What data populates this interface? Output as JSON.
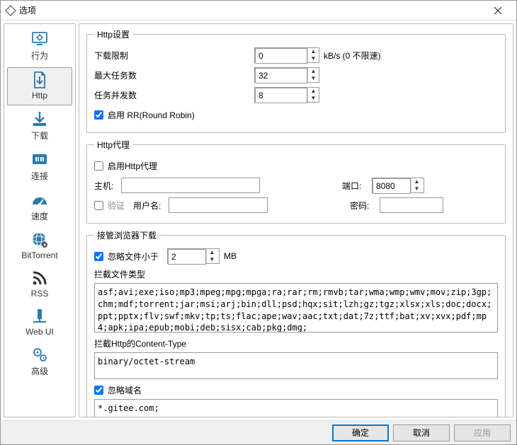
{
  "window": {
    "title": "选项"
  },
  "sidebar": {
    "items": [
      {
        "label": "行为"
      },
      {
        "label": "Http"
      },
      {
        "label": "下载"
      },
      {
        "label": "连接"
      },
      {
        "label": "速度"
      },
      {
        "label": "BitTorrent"
      },
      {
        "label": "RSS"
      },
      {
        "label": "Web UI"
      },
      {
        "label": "高级"
      }
    ]
  },
  "http_settings": {
    "legend": "Http设置",
    "dl_limit_label": "下载限制",
    "dl_limit_value": "0",
    "dl_limit_unit": "kB/s (0 不限速)",
    "max_tasks_label": "最大任务数",
    "max_tasks_value": "32",
    "task_threads_label": "任务并发数",
    "task_threads_value": "8",
    "enable_rr_label": "启用 RR(Round Robin)",
    "enable_rr_checked": true
  },
  "http_proxy": {
    "legend": "Http代理",
    "enable_label": "启用Http代理",
    "enable_checked": false,
    "host_label": "主机:",
    "host_value": "",
    "port_label": "端口:",
    "port_value": "8080",
    "verify_label": "验证",
    "verify_checked": false,
    "user_label": "用户名:",
    "user_value": "",
    "pass_label": "密码:",
    "pass_value": ""
  },
  "browser_capture": {
    "legend": "接管浏览器下载",
    "ignore_size_label": "忽略文件小于",
    "ignore_size_checked": true,
    "ignore_size_value": "2",
    "ignore_size_unit": "MB",
    "file_types_label": "拦截文件类型",
    "file_types_value": "asf;avi;exe;iso;mp3;mpeg;mpg;mpga;ra;rar;rm;rmvb;tar;wma;wmp;wmv;mov;zip;3gp;chm;mdf;torrent;jar;msi;arj;bin;dll;psd;hqx;sit;lzh;gz;tgz;xlsx;xls;doc;docx;ppt;pptx;flv;swf;mkv;tp;ts;flac;ape;wav;aac;txt;dat;7z;ttf;bat;xv;xvx;pdf;mp4;apk;ipa;epub;mobi;deb;sisx;cab;pkg;dmg;",
    "content_type_label": "拦截Http的Content-Type",
    "content_type_value": "binary/octet-stream",
    "ignore_domain_label": "忽略域名",
    "ignore_domain_checked": true,
    "ignore_domain_value": "*.gitee.com;"
  },
  "buttons": {
    "ok": "确定",
    "cancel": "取消",
    "apply": "应用"
  },
  "icons": {
    "color": "#2a7ab0"
  }
}
